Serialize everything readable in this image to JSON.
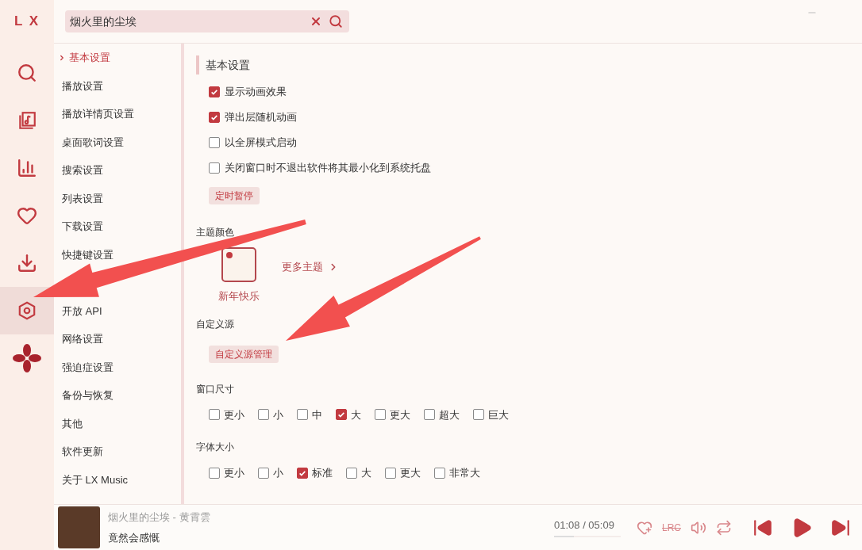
{
  "logo": "L X",
  "nav": [
    {
      "kind": "search",
      "selected": false
    },
    {
      "kind": "songlist",
      "selected": false
    },
    {
      "kind": "chart",
      "selected": false
    },
    {
      "kind": "heart",
      "selected": false
    },
    {
      "kind": "download",
      "selected": false
    },
    {
      "kind": "settings",
      "selected": true
    }
  ],
  "search": {
    "value": "烟火里的尘埃"
  },
  "settings_menu": [
    {
      "label": "基本设置",
      "selected": true
    },
    {
      "label": "播放设置",
      "selected": false
    },
    {
      "label": "播放详情页设置",
      "selected": false
    },
    {
      "label": "桌面歌词设置",
      "selected": false
    },
    {
      "label": "搜索设置",
      "selected": false
    },
    {
      "label": "列表设置",
      "selected": false
    },
    {
      "label": "下载设置",
      "selected": false
    },
    {
      "label": "快捷键设置",
      "selected": false
    },
    {
      "label": "开放 API",
      "selected": false
    },
    {
      "label": "网络设置",
      "selected": false
    },
    {
      "label": "强迫症设置",
      "selected": false
    },
    {
      "label": "备份与恢复",
      "selected": false
    },
    {
      "label": "其他",
      "selected": false
    },
    {
      "label": "软件更新",
      "selected": false
    },
    {
      "label": "关于 LX Music",
      "selected": false
    }
  ],
  "section_title": "基本设置",
  "toggles": [
    {
      "label": "显示动画效果",
      "checked": true
    },
    {
      "label": "弹出层随机动画",
      "checked": true
    },
    {
      "label": "以全屏模式启动",
      "checked": false
    },
    {
      "label": "关闭窗口时不退出软件将其最小化到系统托盘",
      "checked": false
    }
  ],
  "timer_button": "定时暂停",
  "theme": {
    "heading": "主题颜色",
    "current": "新年快乐",
    "more": "更多主题"
  },
  "custom_source": {
    "heading": "自定义源",
    "button": "自定义源管理"
  },
  "window_size": {
    "heading": "窗口尺寸",
    "options": [
      {
        "label": "更小",
        "selected": false
      },
      {
        "label": "小",
        "selected": false
      },
      {
        "label": "中",
        "selected": false
      },
      {
        "label": "大",
        "selected": true
      },
      {
        "label": "更大",
        "selected": false
      },
      {
        "label": "超大",
        "selected": false
      },
      {
        "label": "巨大",
        "selected": false
      }
    ]
  },
  "font_size": {
    "heading": "字体大小",
    "options": [
      {
        "label": "更小",
        "selected": false
      },
      {
        "label": "小",
        "selected": false
      },
      {
        "label": "标准",
        "selected": true
      },
      {
        "label": "大",
        "selected": false
      },
      {
        "label": "更大",
        "selected": false
      },
      {
        "label": "非常大",
        "selected": false
      }
    ]
  },
  "player": {
    "title": "烟火里的尘埃 - 黄霄雲",
    "lyric": "竟然会感慨",
    "time": "01:08 / 05:09",
    "level": 0.3,
    "lyrics_toggle": "LRC"
  }
}
